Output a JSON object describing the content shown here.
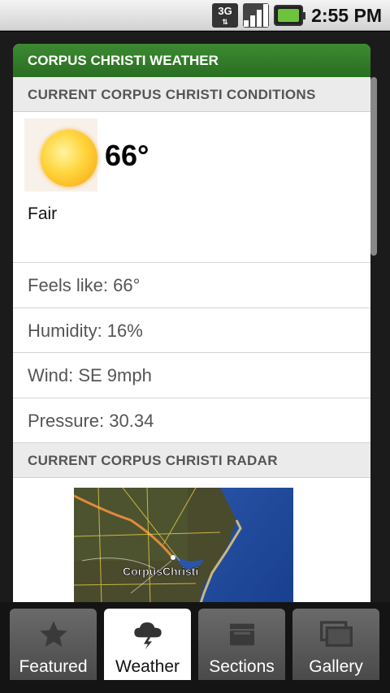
{
  "statusbar": {
    "network": "3G",
    "time": "2:55 PM"
  },
  "weather": {
    "title": "CORPUS CHRISTI WEATHER",
    "conditions_heading": "CURRENT CORPUS CHRISTI CONDITIONS",
    "temperature": "66°",
    "condition": "Fair",
    "details": [
      "Feels like: 66°",
      "Humidity: 16%",
      "Wind: SE 9mph",
      "Pressure: 30.34"
    ],
    "radar_heading": "CURRENT CORPUS CHRISTI RADAR",
    "radar_city_label": "CorpusChristi"
  },
  "tabs": [
    {
      "label": "Featured",
      "icon": "star-icon"
    },
    {
      "label": "Weather",
      "icon": "weather-storm-icon",
      "active": true
    },
    {
      "label": "Sections",
      "icon": "sections-tray-icon"
    },
    {
      "label": "Gallery",
      "icon": "gallery-icon"
    }
  ]
}
